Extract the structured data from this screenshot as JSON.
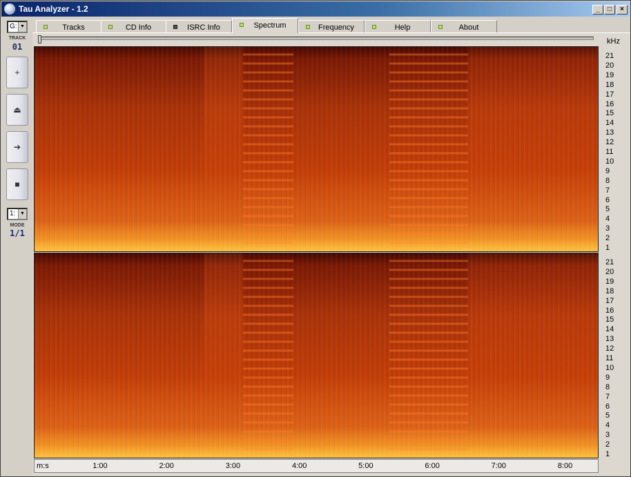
{
  "window": {
    "title": "Tau Analyzer - 1.2",
    "minimize": "_",
    "maximize": "□",
    "close": "×"
  },
  "left_panel": {
    "drive_value": "G:",
    "track_label": "TRACK",
    "track_value": "01",
    "buttons": [
      {
        "name": "add-button",
        "glyph": "+"
      },
      {
        "name": "eject-button",
        "glyph": "⏏"
      },
      {
        "name": "play-button",
        "glyph": "➔"
      },
      {
        "name": "stop-button",
        "glyph": "■"
      }
    ],
    "mode_select_value": "1:",
    "mode_label": "MODE",
    "mode_value": "1/1"
  },
  "tabs": [
    {
      "label": "Tracks",
      "led": "green"
    },
    {
      "label": "CD Info",
      "led": "green"
    },
    {
      "label": "ISRC Info",
      "led": "dark"
    },
    {
      "label": "Spectrum",
      "led": "green",
      "active": true
    },
    {
      "label": "Frequency",
      "led": "green"
    },
    {
      "label": "Help",
      "led": "green"
    },
    {
      "label": "About",
      "led": "green"
    }
  ],
  "freq_axis": {
    "unit": "kHz",
    "ticks": [
      "21",
      "20",
      "19",
      "18",
      "17",
      "16",
      "15",
      "14",
      "13",
      "12",
      "11",
      "10",
      "9",
      "8",
      "7",
      "6",
      "5",
      "4",
      "3",
      "2",
      "1"
    ]
  },
  "time_axis": {
    "unit_label": "m:s",
    "ticks": [
      "1:00",
      "2:00",
      "3:00",
      "4:00",
      "5:00",
      "6:00",
      "7:00",
      "8:00"
    ]
  },
  "colors": {
    "spectrum_low": "#4a0a05",
    "spectrum_mid": "#c8400a",
    "spectrum_high": "#ffb030",
    "titlebar": "#0a246a"
  }
}
